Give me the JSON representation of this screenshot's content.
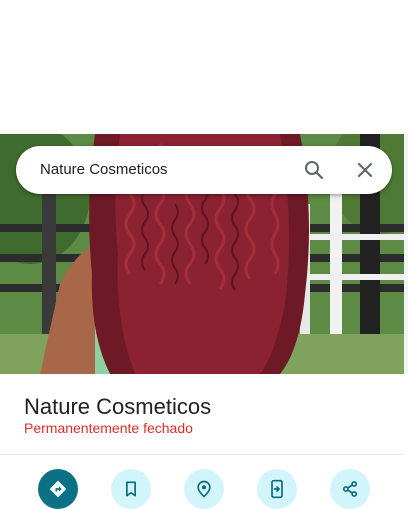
{
  "search": {
    "query": "Nature Cosmeticos"
  },
  "place": {
    "name": "Nature Cosmeticos",
    "status": "Permanentemente fechado"
  },
  "photo": {
    "subject": "curly-red-hair-photo"
  },
  "icons": {
    "search": "search-icon",
    "close": "close-icon",
    "directions": "directions-icon",
    "save": "bookmark-icon",
    "nearby": "nearby-icon",
    "send": "send-to-phone-icon",
    "share": "share-icon"
  },
  "colors": {
    "status": "#d93025",
    "primary_action": "#0b7285",
    "secondary_action": "#d2f4fb",
    "secondary_icon": "#0b6b7d"
  }
}
